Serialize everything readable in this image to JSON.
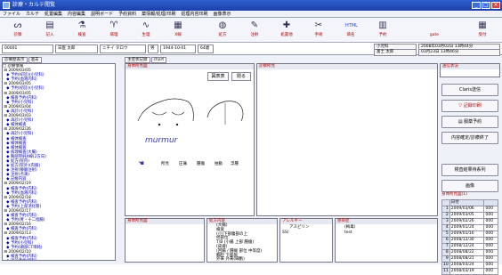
{
  "window": {
    "title": "診療・カルテ閲覧"
  },
  "menu": [
    "ファイル",
    "カルテ",
    "処置編集",
    "内容編集",
    "説明ボード",
    "予約資料",
    "薬情報/処理/印刷",
    "処理内容印刷",
    "画像表示"
  ],
  "toolbar": [
    {
      "label": "診察",
      "icon": "stethoscope-icon",
      "glyph": "ᔕ"
    },
    {
      "label": "記入",
      "icon": "document-icon",
      "glyph": "▤"
    },
    {
      "label": "検査",
      "icon": "flask-icon",
      "glyph": "⚗"
    },
    {
      "label": "病理",
      "icon": "microscope-icon",
      "glyph": "♈"
    },
    {
      "label": "生理",
      "icon": "wave-icon",
      "glyph": "∿"
    },
    {
      "label": "X線",
      "icon": "xray-icon",
      "glyph": "▦"
    },
    {
      "label": "処方",
      "icon": "pill-icon",
      "glyph": "◍"
    },
    {
      "label": "注射",
      "icon": "syringe-icon",
      "glyph": "✎"
    },
    {
      "label": "処置他",
      "icon": "bandage-icon",
      "glyph": "✚"
    },
    {
      "label": "手術",
      "icon": "scalpel-icon",
      "glyph": "✂"
    },
    {
      "label": "病名",
      "icon": "html-icon",
      "glyph": "HTML"
    },
    {
      "label": "予約",
      "icon": "calendar-icon",
      "glyph": "▥"
    },
    {
      "label": "gate",
      "icon": "gate-icon",
      "glyph": ""
    },
    {
      "label": "受付",
      "icon": "reception-icon",
      "glyph": "▦"
    }
  ],
  "patient": {
    "id": "00001",
    "kanji_name": "日医 太郎",
    "kana_name": "ニチイ タロウ",
    "sex": "男",
    "birth": "1944-10-01",
    "age": "64歳",
    "dept": "小児科",
    "doctor": "富士 太郎",
    "date1": "2008年03月02日 13時44分",
    "date2": "03月23日 13時46分"
  },
  "tabs": [
    "診療歴表示",
    "過去"
  ],
  "tree": [
    {
      "t": "□ 診療情報",
      "f": true
    },
    {
      "t": " ⊟ 2009/03/05",
      "f": true
    },
    {
      "t": "   ◆ 予約(初診)(小児科)"
    },
    {
      "t": "   ◆ 予約(血液内科)"
    },
    {
      "t": " ⊟ 2009/03/05",
      "f": true
    },
    {
      "t": "   ◆ 予約(初診)(小児科)"
    },
    {
      "t": " ⊟ 2009/03/05",
      "f": true
    },
    {
      "t": "   ◆ 検査予約(内科)"
    },
    {
      "t": "   ◆ 予約(小児科)"
    },
    {
      "t": " ⊟ 2009/03/04",
      "f": true
    },
    {
      "t": "   ◆ 再診(小児科)"
    },
    {
      "t": " ⊟ 2009/03/03",
      "f": true
    },
    {
      "t": "   ◆ 再診(小児科)"
    },
    {
      "t": "   ◆ 検体検査"
    },
    {
      "t": " ⊟ 2009/02/26",
      "f": true
    },
    {
      "t": "   ◆ 再診(小児科)"
    },
    {
      "t": "   ◆ 検体検査"
    },
    {
      "t": "   ◆ 検体検査"
    },
    {
      "t": "   ◆ 検体検査"
    },
    {
      "t": "   ◆ 病理検査(大腸)"
    },
    {
      "t": "   ◆ 胸部単純X線(2方向)"
    },
    {
      "t": "   ◆ 処方(院内)"
    },
    {
      "t": "   ◆ 処方(院外)(内服)"
    },
    {
      "t": "   ◆ 注射(静脈注射)"
    },
    {
      "t": "   ◆ 注射(点滴)"
    },
    {
      "t": "   ◆ 記帳内容"
    },
    {
      "t": " ⊟ 2009/02/19",
      "f": true
    },
    {
      "t": "   ◆ 検査予約(内科)"
    },
    {
      "t": "   ◆ 予約(血液内科)"
    },
    {
      "t": " ⊟ 2009/02/18",
      "f": true
    },
    {
      "t": "   ◆ 検査予約(内科)"
    },
    {
      "t": "   ◆ 予約(上部消化管)"
    },
    {
      "t": " ⊟ 2009/02/17",
      "f": true
    },
    {
      "t": "   ◆ 検査予約(内科)"
    },
    {
      "t": "   ◆ 予約(胃・十二指腸)"
    },
    {
      "t": " ⊟ 2009/02/16",
      "f": true
    },
    {
      "t": "   ◆ 検査予約(内科)"
    },
    {
      "t": " ⊟ 2009/02/13",
      "f": true
    },
    {
      "t": "   ◆ 検査予約(内科)"
    },
    {
      "t": "   ◆ 予約(小児科)"
    },
    {
      "t": "   ◆ 予約(頭部CT単純)"
    },
    {
      "t": " ⊟ 2009/02/10",
      "f": true
    },
    {
      "t": "   ◆ 検査予約(内科)"
    },
    {
      "t": "   ◆ 再診予約(眼科)"
    },
    {
      "t": " ⊟ 2009/02/09",
      "f": true
    },
    {
      "t": "   ◆ 検査予約(内科)"
    },
    {
      "t": "   ◆ 予約(腹部超音波)"
    }
  ],
  "panels": {
    "main": "身体所見図",
    "exam": "診察所見",
    "bottom_left": "身体所見図",
    "mid": "処方内容",
    "allergy": "アレルギー",
    "notes": "感染症",
    "status": "送信状況"
  },
  "figure_buttons": {
    "ok": "図表表",
    "close": "閉る"
  },
  "figure_text": {
    "murmur": "murmur",
    "legend": [
      "所見",
      "圧痛",
      "腫瘤",
      "拍動",
      "浮腫"
    ]
  },
  "right_buttons": [
    "Claris送信",
    "記録印刷",
    "服薬予約",
    "内容確定/診療終了",
    "検査結果待系列",
    "画像"
  ],
  "history_table": {
    "title": "身体所見図(1)",
    "header": [
      "",
      "日付",
      ""
    ],
    "rows": [
      [
        "1",
        "2009/03/06",
        "000"
      ],
      [
        "2",
        "2009/03/05",
        "000"
      ],
      [
        "3",
        "2009/02/26",
        "000"
      ],
      [
        "4",
        "2009/01/24",
        "000"
      ],
      [
        "5",
        "2009/01/16",
        "000"
      ],
      [
        "6",
        "2008/12/30",
        "000"
      ],
      [
        "7",
        "2008/12/24",
        "000"
      ],
      [
        "8",
        "2008/08/22",
        "000"
      ],
      [
        "9",
        "2008/08/21",
        "000"
      ],
      [
        "10",
        "2008/03/24",
        "000"
      ],
      [
        "11",
        "2008/03/19",
        "000"
      ]
    ]
  },
  "mid_text": [
    "(大腸)",
    "検査",
    "(小)下部腹部の上",
    "他部位",
    "T/B (小腸 上部 腫瘤)",
    "(皮膚)",
    "(回腸 / 腫瘍 部位 中等度)",
    "胸腔 下部部",
    "外来 外来(細胞)"
  ],
  "allergy_text": [
    "アスピリン",
    "SSI"
  ],
  "notes_text": [
    "(梅毒)",
    "test"
  ],
  "mini_labels": {
    "doc_tab": "主症状記録",
    "chart_tab": "chart"
  },
  "colors": {
    "title": "#1c3fa8",
    "accent": "#a00000",
    "selected": "#3a6de0"
  }
}
